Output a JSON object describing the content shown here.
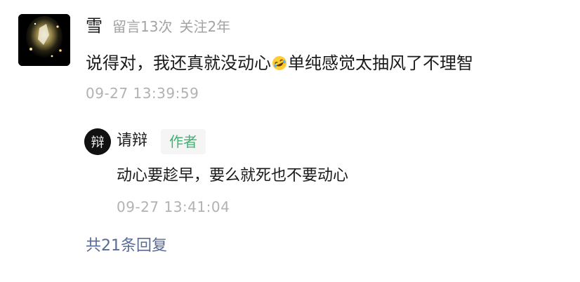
{
  "comment": {
    "user_name": "雪",
    "message_count": "留言13次",
    "follow_duration": "关注2年",
    "text_before_emoji": "说得对，我还真就没动心",
    "emoji": "rolling-on-floor-laughing-emoji",
    "text_after_emoji": "单纯感觉太抽风了不理智",
    "timestamp": "09-27 13:39:59"
  },
  "reply": {
    "user_name": "请辩",
    "author_badge": "作者",
    "avatar_glyph": "辩",
    "text": "动心要趁早，要么就死也不要动心",
    "timestamp": "09-27 13:41:04"
  },
  "more_replies_label": "共21条回复",
  "colors": {
    "link": "#576b95",
    "badge_text": "#3cb371",
    "badge_bg": "#f5f5f5",
    "meta_text": "#a3a3a3"
  }
}
